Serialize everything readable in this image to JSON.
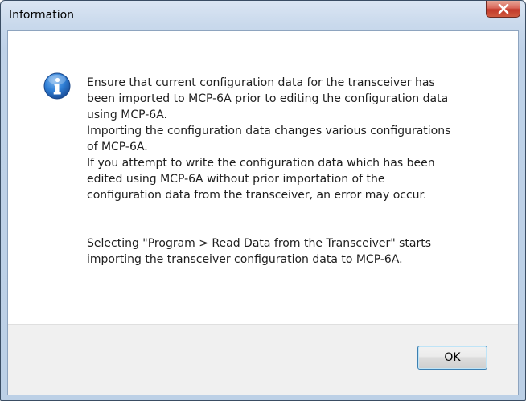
{
  "window": {
    "title": "Information",
    "close_icon": "close-icon"
  },
  "dialog": {
    "icon": "information-icon",
    "message_block1": [
      "Ensure that current configuration data for the transceiver has",
      "been imported to MCP-6A prior to editing the configuration data",
      "using MCP-6A.",
      "Importing the configuration data changes various configurations",
      "of MCP-6A.",
      "If you attempt to write the configuration data which has been",
      "edited using MCP-6A without prior importation of the",
      "configuration data from the transceiver, an error may occur."
    ],
    "message_block2": [
      "Selecting \"Program > Read Data from the Transceiver\" starts",
      "importing the transceiver configuration data to MCP-6A."
    ],
    "ok_label": "OK"
  },
  "colors": {
    "titlebar": "#c9d9ec",
    "close_button": "#c2392a",
    "footer": "#f0f0f0",
    "ok_border": "#3c7fb1",
    "info_icon": "#1b5fb0"
  }
}
